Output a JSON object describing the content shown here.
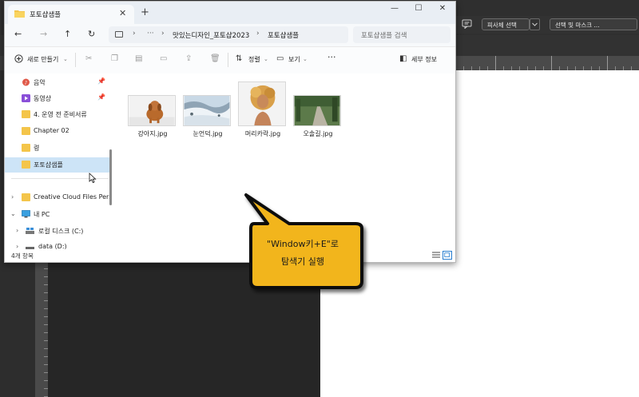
{
  "photoshop": {
    "subject_select_label": "피사체 선택",
    "select_mask_label": "선택 및 마스크 ..."
  },
  "explorer": {
    "tab_title": "포토샵샘플",
    "address_crumbs": [
      "맛있는디자인_포토샵2023",
      "포토샵샘플"
    ],
    "search_placeholder": "포토샵샘플 검색",
    "commands": {
      "new": "새로 만들기",
      "sort": "정렬",
      "view": "보기",
      "details": "세부 정보"
    },
    "sidebar": [
      {
        "label": "음악",
        "icon": "music-icon",
        "pinned": true
      },
      {
        "label": "동영상",
        "icon": "video-icon",
        "pinned": true
      },
      {
        "label": "4. 운영 전 준비서류",
        "icon": "folder-icon",
        "pinned": false
      },
      {
        "label": "Chapter 02",
        "icon": "folder-icon",
        "pinned": false
      },
      {
        "label": "령",
        "icon": "folder-icon",
        "pinned": false
      },
      {
        "label": "포토샵샘플",
        "icon": "folder-icon",
        "pinned": false,
        "selected": true
      },
      {
        "label": "Creative Cloud Files Personal",
        "icon": "folder-icon",
        "pinned": false
      },
      {
        "label": "내 PC",
        "icon": "pc-icon",
        "pinned": false
      },
      {
        "label": "로컬 디스크 (C:)",
        "icon": "disk-icon",
        "pinned": false
      },
      {
        "label": "data (D:)",
        "icon": "disk-icon",
        "pinned": false
      }
    ],
    "files": [
      {
        "name": "강아지.jpg",
        "thumb": "puppy"
      },
      {
        "name": "눈언덕.jpg",
        "thumb": "snow-hill"
      },
      {
        "name": "머리카락.jpg",
        "thumb": "hair"
      },
      {
        "name": "오솔길.jpg",
        "thumb": "path"
      }
    ],
    "status": "4개 항목"
  },
  "callout": {
    "line1": "\"Window키+E\"로",
    "line2": "탐색기 실행",
    "fill": "#f2b51d",
    "border": "#111111"
  }
}
